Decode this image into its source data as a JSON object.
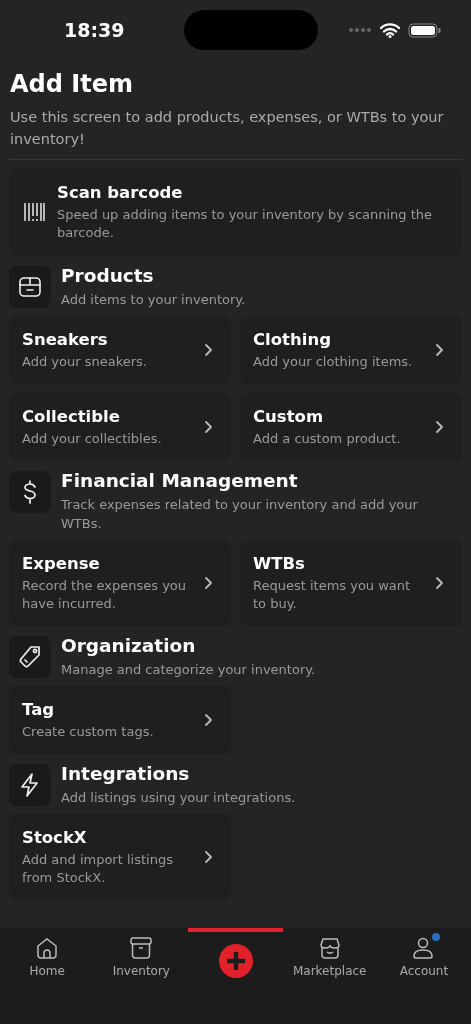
{
  "status_bar": {
    "time": "18:39"
  },
  "title": "Add Item",
  "subtitle": "Use this screen to add products, expenses, or WTBs to your inventory!",
  "scan": {
    "title": "Scan barcode",
    "description": "Speed up adding items to your inventory by scanning the barcode."
  },
  "sections": [
    {
      "title": "Products",
      "description": "Add items to your inventory.",
      "items": [
        {
          "title": "Sneakers",
          "description": "Add your sneakers."
        },
        {
          "title": "Clothing",
          "description": "Add your clothing items."
        },
        {
          "title": "Collectible",
          "description": "Add your collectibles."
        },
        {
          "title": "Custom",
          "description": "Add a custom product."
        }
      ]
    },
    {
      "title": "Financial Management",
      "description": "Track expenses related to your inventory and add your WTBs.",
      "items": [
        {
          "title": "Expense",
          "description": "Record the expenses you have incurred."
        },
        {
          "title": "WTBs",
          "description": "Request items you want to buy."
        }
      ]
    },
    {
      "title": "Organization",
      "description": "Manage and categorize your inventory.",
      "items": [
        {
          "title": "Tag",
          "description": "Create custom tags."
        }
      ]
    },
    {
      "title": "Integrations",
      "description": "Add listings using your integrations.",
      "items": [
        {
          "title": "StockX",
          "description": "Add and import listings from StockX."
        }
      ]
    }
  ],
  "tab_bar": [
    {
      "label": "Home",
      "selected": false,
      "notification": false
    },
    {
      "label": "Inventory",
      "selected": false,
      "notification": false
    },
    {
      "kind": "add",
      "selected": true
    },
    {
      "label": "Marketplace",
      "selected": false,
      "notification": false
    },
    {
      "label": "Account",
      "selected": false,
      "notification": true
    }
  ]
}
